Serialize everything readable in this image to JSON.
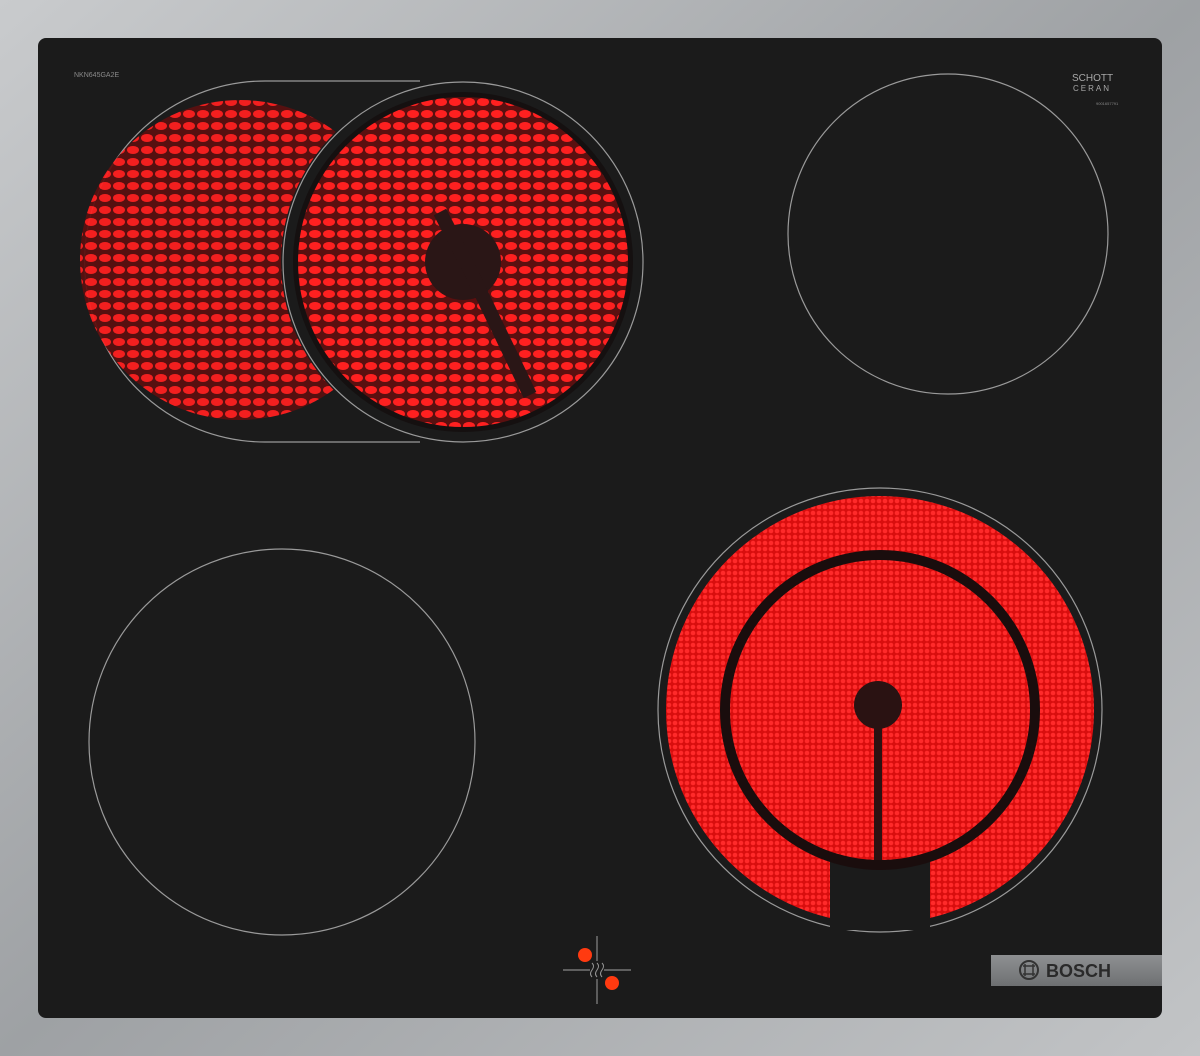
{
  "hob": {
    "model_label": "NKN645GA2E",
    "glass_brand_line1": "SCHOTT",
    "glass_brand_line2": "CERAN",
    "glass_serial": "9001657791",
    "brand": "BOSCH",
    "colors": {
      "frame": "#a9abad",
      "glass": "#1b1b1b",
      "heat": "#ff1a1a",
      "indicator": "#ff3a10",
      "outline": "#9a9a9a"
    },
    "zones": [
      {
        "id": "top-left-dual",
        "state": "heated",
        "icon": "dual-oval-zone"
      },
      {
        "id": "top-right",
        "state": "off"
      },
      {
        "id": "bottom-left",
        "state": "off"
      },
      {
        "id": "bottom-right-dual",
        "state": "heated",
        "icon": "dual-ring-zone"
      }
    ],
    "control_icon": "residual-heat-indicator-icon"
  }
}
